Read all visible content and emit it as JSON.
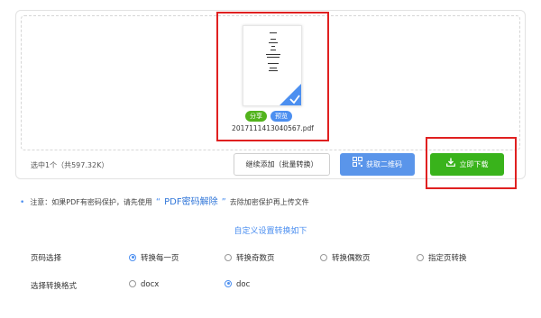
{
  "upload": {
    "file_name": "2017111413040567.pdf",
    "share_tag": "分享",
    "preview_tag": "预览",
    "selected_info": "选中1个（共597.32K）",
    "continue_add_label": "继续添加（批量转换）",
    "get_qr_label": "获取二维码",
    "download_label": "立即下载"
  },
  "notice": {
    "prefix": "注意：如果PDF有密码保护，请先使用",
    "quote_open": "“",
    "link_text": "PDF密码解除",
    "quote_close": "”",
    "suffix": "去除加密保护再上传文件"
  },
  "settings": {
    "title": "自定义设置转换如下",
    "page_select_label": "页码选择",
    "page_options": [
      "转换每一页",
      "转换奇数页",
      "转换偶数页",
      "指定页转换"
    ],
    "page_selected": "转换每一页",
    "format_label": "选择转换格式",
    "format_options": [
      "docx",
      "doc"
    ],
    "format_selected": "doc"
  },
  "colors": {
    "accent_blue": "#4c8ff0",
    "download_green": "#39b31b",
    "highlight_red": "#e02020"
  }
}
